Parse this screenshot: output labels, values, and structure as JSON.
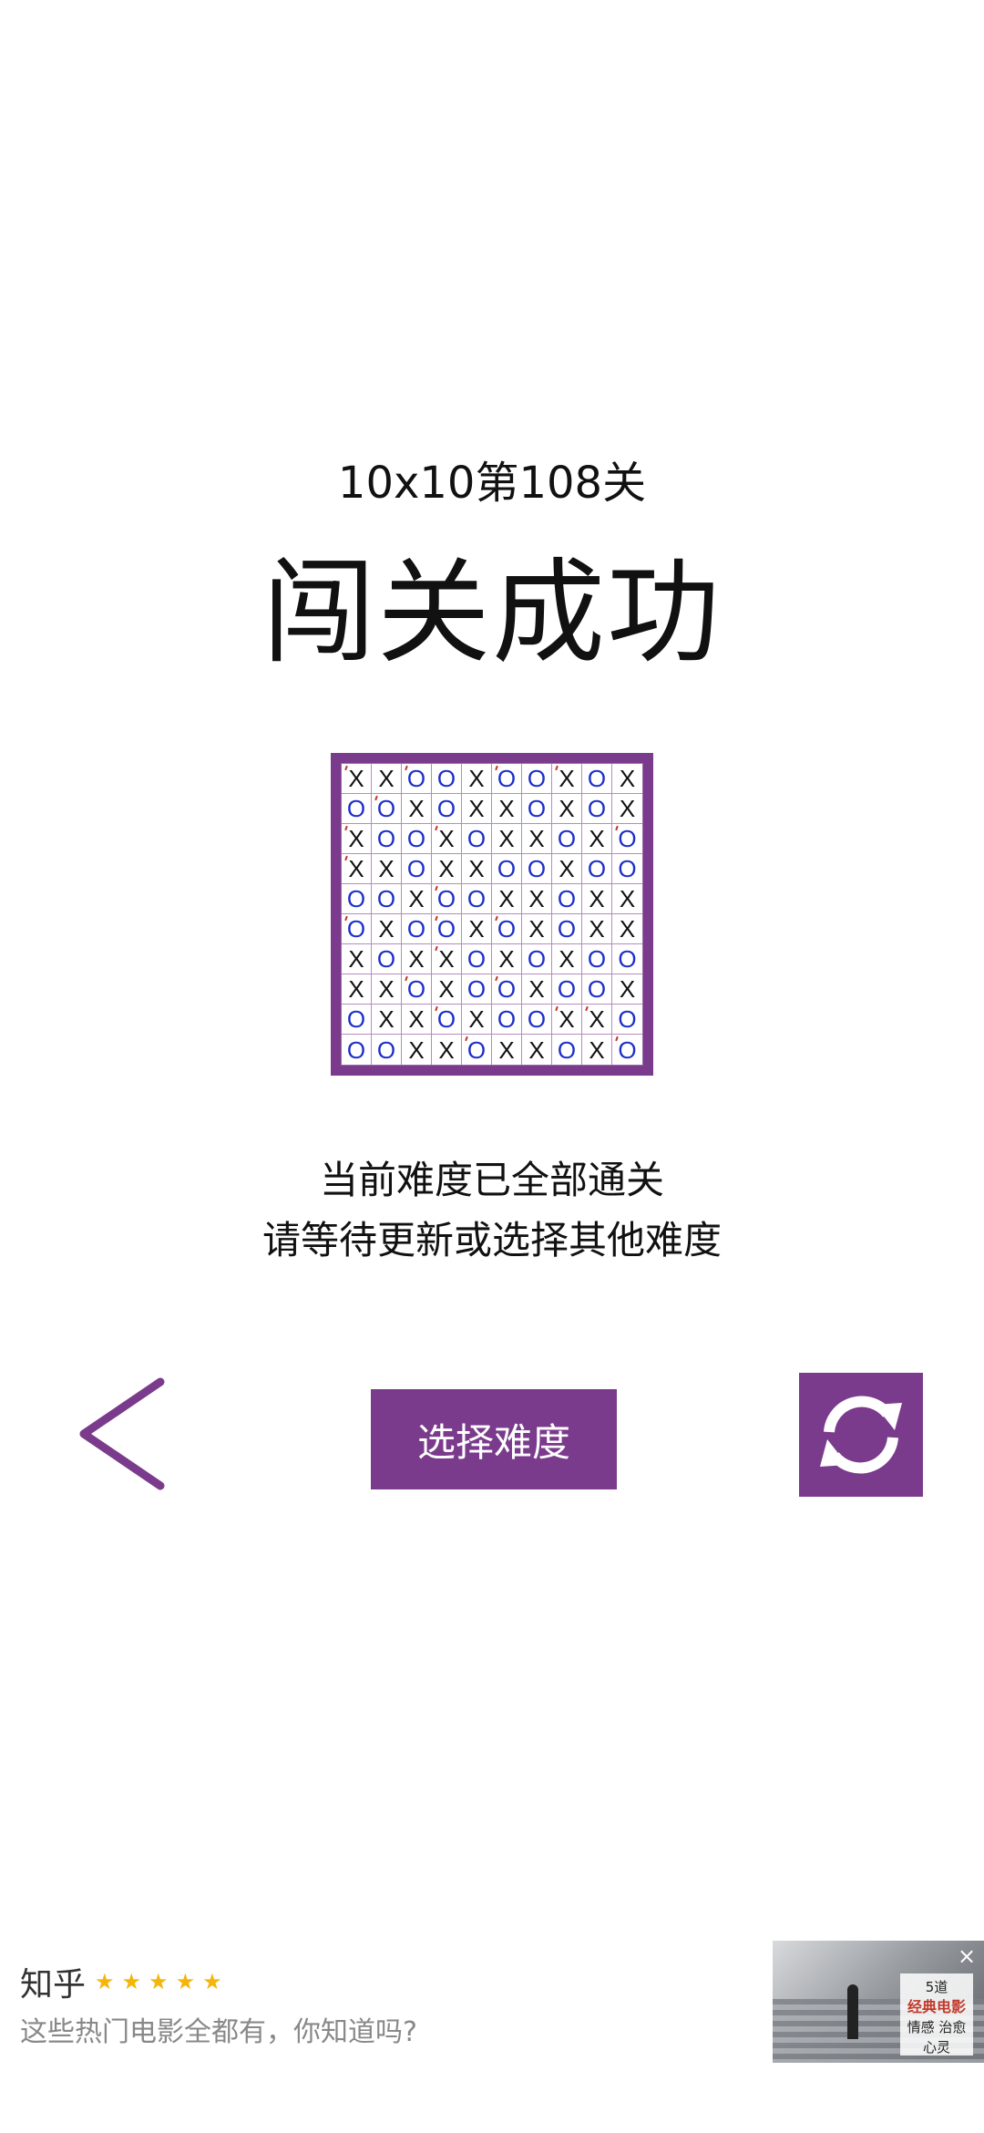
{
  "header": {
    "level_title": "10x10第108关",
    "success_title": "闯关成功"
  },
  "board": {
    "rows": [
      [
        "X",
        "X",
        "O",
        "O",
        "X",
        "O",
        "O",
        "X",
        "O",
        "X"
      ],
      [
        "O",
        "O",
        "X",
        "O",
        "X",
        "X",
        "O",
        "X",
        "O",
        "X"
      ],
      [
        "X",
        "O",
        "O",
        "X",
        "O",
        "X",
        "X",
        "O",
        "X",
        "O"
      ],
      [
        "X",
        "X",
        "O",
        "X",
        "X",
        "O",
        "O",
        "X",
        "O",
        "O"
      ],
      [
        "O",
        "O",
        "X",
        "O",
        "O",
        "X",
        "X",
        "O",
        "X",
        "X"
      ],
      [
        "O",
        "X",
        "O",
        "O",
        "X",
        "O",
        "X",
        "O",
        "X",
        "X"
      ],
      [
        "X",
        "O",
        "X",
        "X",
        "O",
        "X",
        "O",
        "X",
        "O",
        "O"
      ],
      [
        "X",
        "X",
        "O",
        "X",
        "O",
        "O",
        "X",
        "O",
        "O",
        "X"
      ],
      [
        "O",
        "X",
        "X",
        "O",
        "X",
        "O",
        "O",
        "X",
        "X",
        "O"
      ],
      [
        "O",
        "O",
        "X",
        "X",
        "O",
        "X",
        "X",
        "O",
        "X",
        "O"
      ]
    ],
    "given_marks": [
      [
        0,
        0
      ],
      [
        0,
        2
      ],
      [
        0,
        5
      ],
      [
        0,
        7
      ],
      [
        1,
        1
      ],
      [
        2,
        0
      ],
      [
        2,
        3
      ],
      [
        2,
        9
      ],
      [
        3,
        0
      ],
      [
        4,
        3
      ],
      [
        5,
        0
      ],
      [
        5,
        3
      ],
      [
        5,
        5
      ],
      [
        6,
        3
      ],
      [
        7,
        2
      ],
      [
        7,
        5
      ],
      [
        8,
        3
      ],
      [
        8,
        7
      ],
      [
        8,
        8
      ],
      [
        9,
        4
      ],
      [
        9,
        9
      ]
    ]
  },
  "message": {
    "line1": "当前难度已全部通关",
    "line2": "请等待更新或选择其他难度"
  },
  "controls": {
    "select_label": "选择难度",
    "back_icon": "chevron-left-icon",
    "refresh_icon": "refresh-icon"
  },
  "ad": {
    "brand": "知乎",
    "stars": 5,
    "text": "这些热门电影全都有，你知道吗?",
    "image_line1": "5道",
    "image_line2": "经典电影",
    "image_line3": "情感 治愈 心灵"
  },
  "colors": {
    "accent": "#7b3b8c",
    "o_mark": "#1d2fc9",
    "x_mark": "#111111",
    "star": "#f5b50a"
  }
}
